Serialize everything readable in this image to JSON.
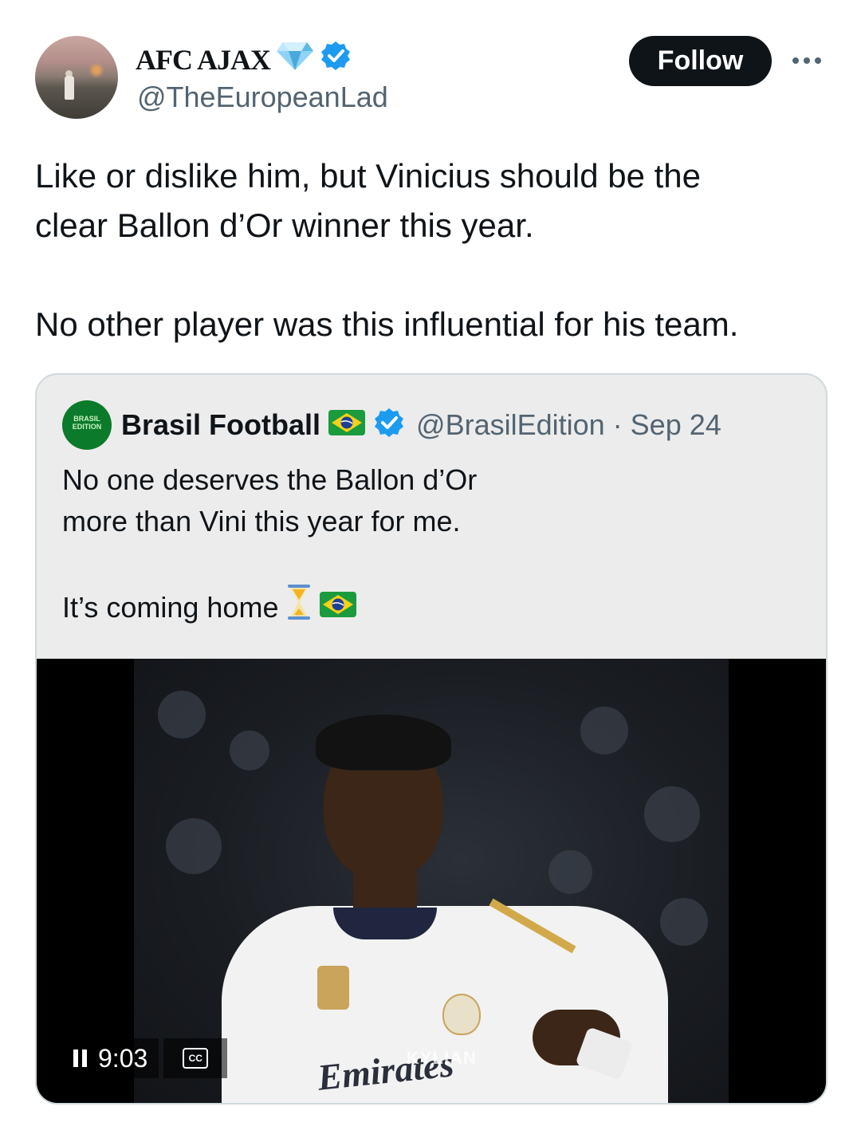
{
  "author": {
    "name": "AFC AJAX",
    "handle": "@TheEuropeanLad",
    "verified": true,
    "name_emoji": "diamond-icon"
  },
  "actions": {
    "follow_label": "Follow",
    "more_icon": "more-horizontal-icon"
  },
  "tweet": {
    "line1": "Like or dislike him, but Vinicius should be the",
    "line2": "clear Ballon d’Or winner this year.",
    "line3": "No other player was this influential for his team."
  },
  "quote": {
    "name": "Brasil Football",
    "name_flag": "brazil-flag-icon",
    "verified": true,
    "handle": "@BrasilEdition",
    "separator": "·",
    "date": "Sep 24",
    "line1": "No one deserves the Ballon d’Or",
    "line2": "more than Vini this year for me.",
    "line3": "It’s coming home",
    "line3_emojis": [
      "hourglass-icon",
      "brazil-flag-icon"
    ],
    "avatar_text": "BRASIL EDITION",
    "video": {
      "time": "9:03",
      "playing": true,
      "sponsor_text": "Emirates",
      "watermark": "KYLIAN"
    }
  },
  "colors": {
    "text": "#0f1419",
    "muted": "#536471",
    "verified": "#1d9bf0",
    "follow_bg": "#0f1419",
    "quote_bg": "#ececec",
    "border": "#cfd9de"
  }
}
